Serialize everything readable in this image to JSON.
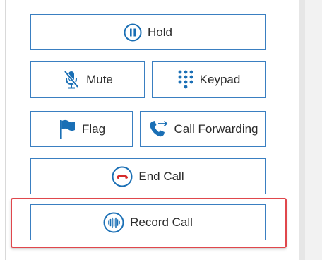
{
  "call_controls": {
    "hold_label": "Hold",
    "mute_label": "Mute",
    "keypad_label": "Keypad",
    "flag_label": "Flag",
    "call_forwarding_label": "Call Forwarding",
    "end_call_label": "End Call",
    "record_call_label": "Record Call"
  },
  "icons": {
    "hold": "pause-circle-icon",
    "mute": "microphone-muted-icon",
    "keypad": "keypad-dots-icon",
    "flag": "flag-icon",
    "call_forwarding": "phone-forward-icon",
    "end_call": "hang-up-icon",
    "record_call": "audio-wave-icon"
  },
  "colors": {
    "accent_blue": "#1a6fb5",
    "button_border": "#3a7fc1",
    "end_call_red": "#d62b2b",
    "highlight_red": "#e0474c"
  }
}
